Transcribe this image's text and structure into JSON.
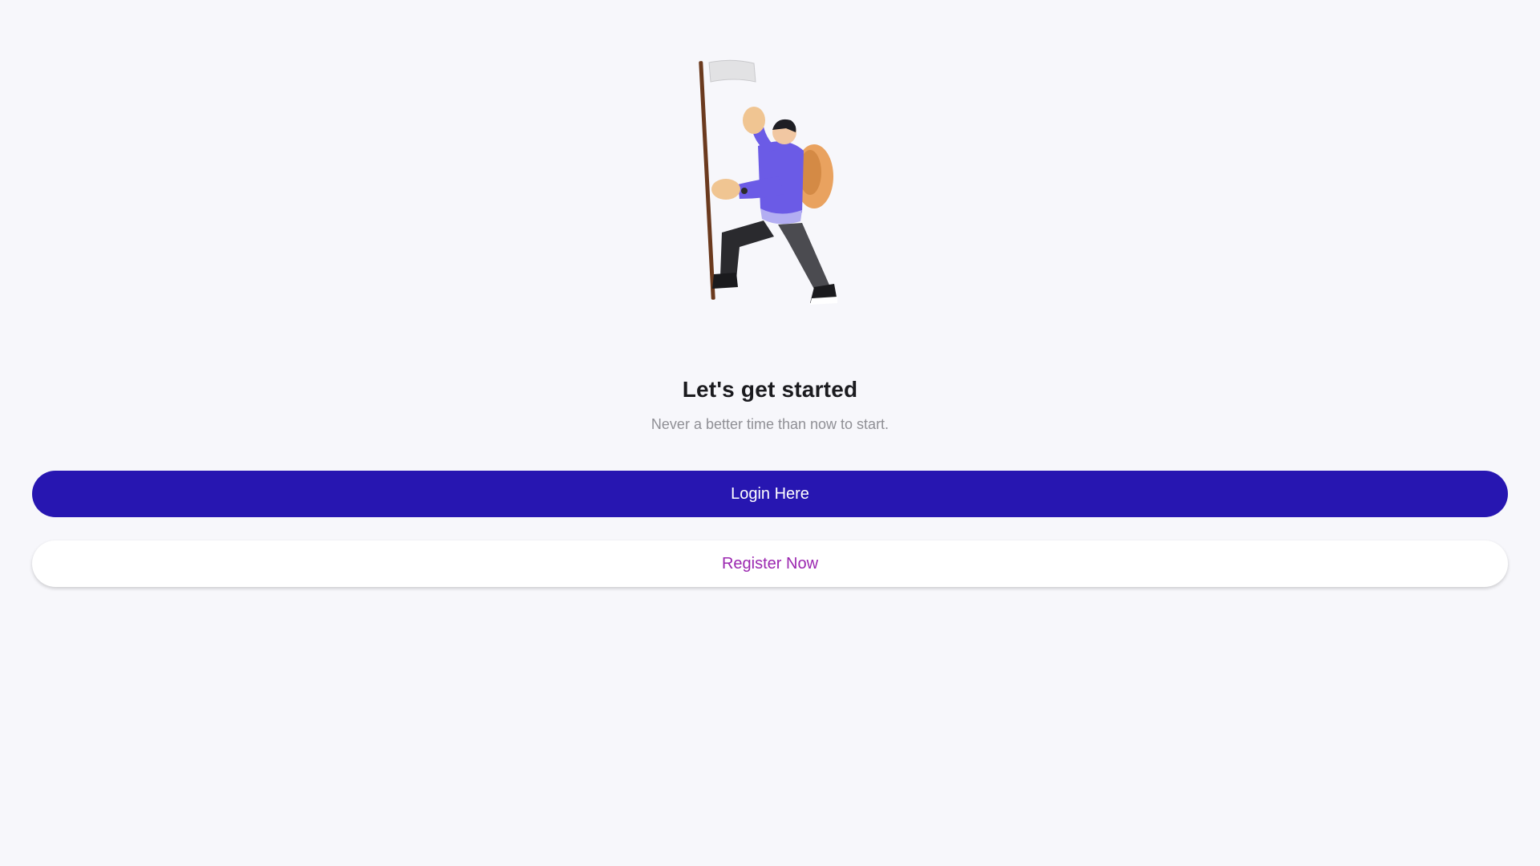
{
  "welcome": {
    "title": "Let's get started",
    "subtitle": "Never a better time than now to start.",
    "illustration_icon": "hiker-with-flag-icon"
  },
  "actions": {
    "login_label": "Login Here",
    "register_label": "Register Now"
  },
  "colors": {
    "background": "#f7f7fb",
    "primary": "#2716b1",
    "accent_text": "#9b27b0",
    "title_text": "#1b1b1f",
    "subtitle_text": "#8f8f95"
  }
}
